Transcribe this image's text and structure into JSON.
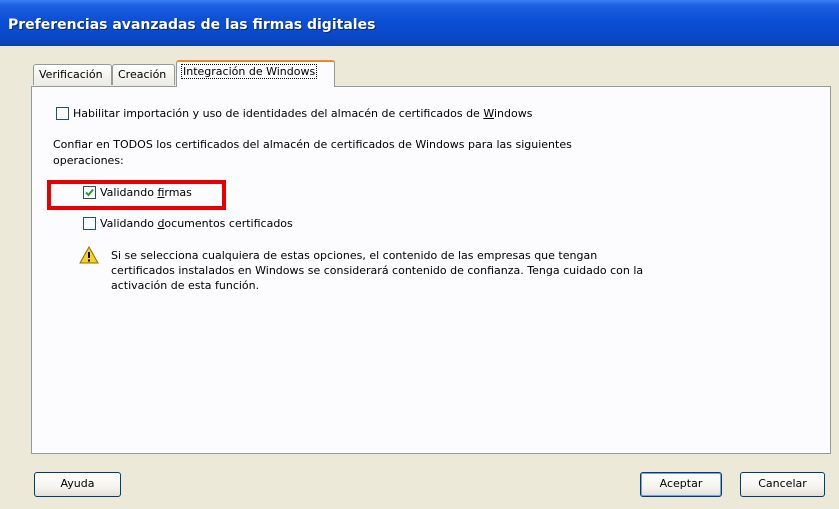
{
  "window": {
    "title": "Preferencias avanzadas de las firmas digitales"
  },
  "tabs": [
    {
      "label": "Verificación",
      "selected": false
    },
    {
      "label": "Creación",
      "selected": false
    },
    {
      "label": "Integración de Windows",
      "selected": true
    }
  ],
  "panel": {
    "enable_checkbox": {
      "prefix": "Habilitar importación y uso de identidades del almacén de certificados de ",
      "underlined": "W",
      "suffix": "indows",
      "checked": false
    },
    "trust_text_line1": "Confiar en TODOS los certificados del almacén de certificados de Windows para las siguientes",
    "trust_text_line2": "operaciones:",
    "validate_signatures": {
      "prefix": "Validando ",
      "underlined": "f",
      "suffix": "irmas",
      "checked": true
    },
    "validate_documents": {
      "prefix": "Validando ",
      "underlined": "d",
      "suffix": "ocumentos certificados",
      "checked": false
    },
    "warning": {
      "icon": "warning-triangle-icon",
      "line1": "Si se selecciona cualquiera de estas opciones, el contenido de las empresas que tengan",
      "line2": "certificados instalados en Windows se considerará contenido de confianza. Tenga cuidado con la",
      "line3": "activación de esta función."
    }
  },
  "buttons": {
    "help": "Ayuda",
    "ok": "Aceptar",
    "cancel": "Cancelar"
  },
  "colors": {
    "titlebar": "#0b4fd6",
    "highlight": "#e60000",
    "checkmark": "#21a121",
    "dialog_bg": "#ece9d8"
  }
}
